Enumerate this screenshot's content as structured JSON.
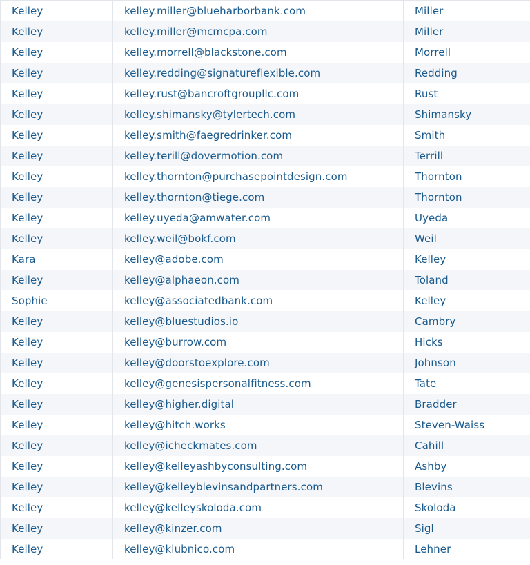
{
  "table": {
    "rows": [
      {
        "first_name": "Kelley",
        "email": "kelley.miller@blueharborbank.com",
        "last_name": "Miller"
      },
      {
        "first_name": "Kelley",
        "email": "kelley.miller@mcmcpa.com",
        "last_name": "Miller"
      },
      {
        "first_name": "Kelley",
        "email": "kelley.morrell@blackstone.com",
        "last_name": "Morrell"
      },
      {
        "first_name": "Kelley",
        "email": "kelley.redding@signatureflexible.com",
        "last_name": "Redding"
      },
      {
        "first_name": "Kelley",
        "email": "kelley.rust@bancroftgroupllc.com",
        "last_name": "Rust"
      },
      {
        "first_name": "Kelley",
        "email": "kelley.shimansky@tylertech.com",
        "last_name": "Shimansky"
      },
      {
        "first_name": "Kelley",
        "email": "kelley.smith@faegredrinker.com",
        "last_name": "Smith"
      },
      {
        "first_name": "Kelley",
        "email": "kelley.terill@dovermotion.com",
        "last_name": "Terrill"
      },
      {
        "first_name": "Kelley",
        "email": "kelley.thornton@purchasepointdesign.com",
        "last_name": "Thornton"
      },
      {
        "first_name": "Kelley",
        "email": "kelley.thornton@tiege.com",
        "last_name": "Thornton"
      },
      {
        "first_name": "Kelley",
        "email": "kelley.uyeda@amwater.com",
        "last_name": "Uyeda"
      },
      {
        "first_name": "Kelley",
        "email": "kelley.weil@bokf.com",
        "last_name": "Weil"
      },
      {
        "first_name": "Kara",
        "email": "kelley@adobe.com",
        "last_name": "Kelley"
      },
      {
        "first_name": "Kelley",
        "email": "kelley@alphaeon.com",
        "last_name": "Toland"
      },
      {
        "first_name": "Sophie",
        "email": "kelley@associatedbank.com",
        "last_name": "Kelley"
      },
      {
        "first_name": "Kelley",
        "email": "kelley@bluestudios.io",
        "last_name": "Cambry"
      },
      {
        "first_name": "Kelley",
        "email": "kelley@burrow.com",
        "last_name": "Hicks"
      },
      {
        "first_name": "Kelley",
        "email": "kelley@doorstoexplore.com",
        "last_name": "Johnson"
      },
      {
        "first_name": "Kelley",
        "email": "kelley@genesispersonalfitness.com",
        "last_name": "Tate"
      },
      {
        "first_name": "Kelley",
        "email": "kelley@higher.digital",
        "last_name": "Bradder"
      },
      {
        "first_name": "Kelley",
        "email": "kelley@hitch.works",
        "last_name": "Steven-Waiss"
      },
      {
        "first_name": "Kelley",
        "email": "kelley@icheckmates.com",
        "last_name": "Cahill"
      },
      {
        "first_name": "Kelley",
        "email": "kelley@kelleyashbyconsulting.com",
        "last_name": "Ashby"
      },
      {
        "first_name": "Kelley",
        "email": "kelley@kelleyblevinsandpartners.com",
        "last_name": "Blevins"
      },
      {
        "first_name": "Kelley",
        "email": "kelley@kelleyskoloda.com",
        "last_name": "Skoloda"
      },
      {
        "first_name": "Kelley",
        "email": "kelley@kinzer.com",
        "last_name": "Sigl"
      },
      {
        "first_name": "Kelley",
        "email": "kelley@klubnico.com",
        "last_name": "Lehner"
      }
    ]
  },
  "colors": {
    "text": "#1a5a8c",
    "row_alt_bg": "#f5f6f9",
    "grid_line": "#e2e5ea"
  }
}
